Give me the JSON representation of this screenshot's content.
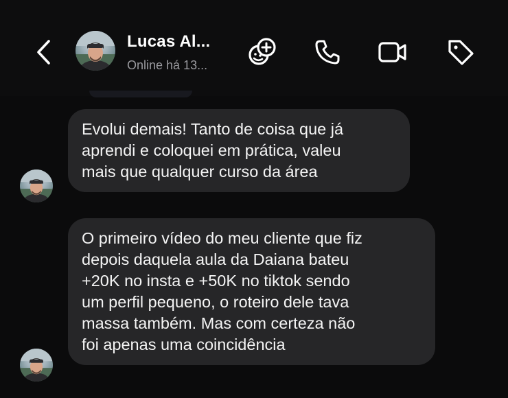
{
  "header": {
    "contact_name": "Lucas Al...",
    "status": "Online há 13...",
    "icons": [
      "back-chevron-icon",
      "sticker-add-icon",
      "phone-icon",
      "video-camera-icon",
      "tag-icon"
    ]
  },
  "messages": [
    {
      "sender": "contact",
      "lines": [
        "Evolui demais! Tanto de coisa que já",
        "aprendi e coloquei em prática, valeu",
        "mais que qualquer curso da área"
      ]
    },
    {
      "sender": "contact",
      "lines": [
        "O primeiro vídeo do meu cliente que fiz",
        "depois daquela aula da Daiana bateu",
        "+20K no insta e +50K no tiktok sendo",
        "um perfil pequeno, o roteiro dele tava",
        "massa também. Mas com certeza não",
        "foi apenas uma coincidência"
      ]
    }
  ],
  "colors": {
    "background": "#0b0b0c",
    "bubble": "#262628",
    "text": "#f4f4f4",
    "status_text": "#9a9a9f"
  }
}
